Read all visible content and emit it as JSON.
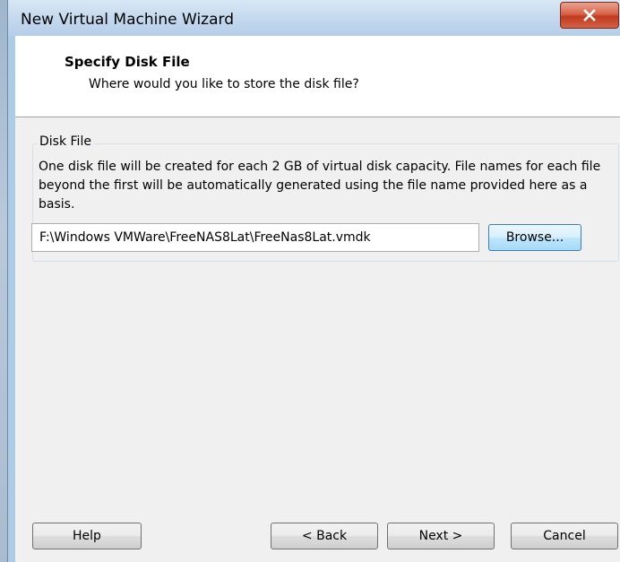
{
  "window": {
    "title": "New Virtual Machine Wizard",
    "close_label": "close"
  },
  "header": {
    "title": "Specify Disk File",
    "subtitle": "Where would you like to store the disk file?"
  },
  "disk_file": {
    "group_label": "Disk File",
    "description": "One disk file will be created for each 2 GB of virtual disk capacity. File names for each file beyond the first will be automatically generated using the file name provided here as a basis.",
    "path_value": "F:\\Windows VMWare\\FreeNAS8Lat\\FreeNas8Lat.vmdk",
    "browse_label": "Browse..."
  },
  "footer": {
    "help_label": "Help",
    "back_label": "< Back",
    "next_label": "Next >",
    "cancel_label": "Cancel"
  },
  "colors": {
    "title_bar": "#c3d8ee",
    "close_button": "#c13a1e",
    "dialog_background": "#f0f0f0"
  },
  "icons": {
    "close": "close-icon"
  }
}
